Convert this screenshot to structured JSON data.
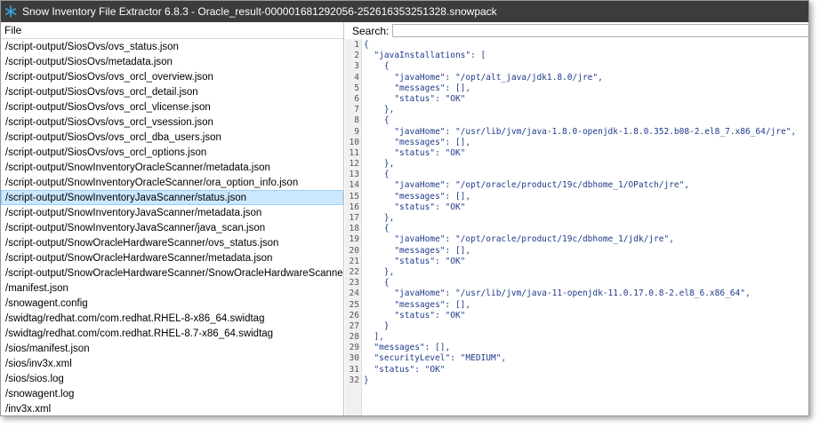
{
  "window": {
    "title": "Snow Inventory File Extractor 6.8.3 - Oracle_result-000001681292056-252616353251328.snowpack",
    "icon": "snowflake-icon",
    "accent_color": "#3aa0d8",
    "titlebar_color": "#3c3c3c"
  },
  "left_pane": {
    "header": "File",
    "selected_index": 10,
    "files": [
      "/script-output/SiosOvs/ovs_status.json",
      "/script-output/SiosOvs/metadata.json",
      "/script-output/SiosOvs/ovs_orcl_overview.json",
      "/script-output/SiosOvs/ovs_orcl_detail.json",
      "/script-output/SiosOvs/ovs_orcl_vlicense.json",
      "/script-output/SiosOvs/ovs_orcl_vsession.json",
      "/script-output/SiosOvs/ovs_orcl_dba_users.json",
      "/script-output/SiosOvs/ovs_orcl_options.json",
      "/script-output/SnowInventoryOracleScanner/metadata.json",
      "/script-output/SnowInventoryOracleScanner/ora_option_info.json",
      "/script-output/SnowInventoryJavaScanner/status.json",
      "/script-output/SnowInventoryJavaScanner/metadata.json",
      "/script-output/SnowInventoryJavaScanner/java_scan.json",
      "/script-output/SnowOracleHardwareScanner/ovs_status.json",
      "/script-output/SnowOracleHardwareScanner/metadata.json",
      "/script-output/SnowOracleHardwareScanner/SnowOracleHardwareScanner.json",
      "/manifest.json",
      "/snowagent.config",
      "/swidtag/redhat.com/com.redhat.RHEL-8-x86_64.swidtag",
      "/swidtag/redhat.com/com.redhat.RHEL-8.7-x86_64.swidtag",
      "/sios/manifest.json",
      "/sios/inv3x.xml",
      "/sios/sios.log",
      "/snowagent.log",
      "/inv3x.xml"
    ]
  },
  "right_pane": {
    "search_label": "Search:",
    "search_value": "",
    "code_lines": [
      "{",
      "  \"javaInstallations\": [",
      "    {",
      "      \"javaHome\": \"/opt/alt_java/jdk1.8.0/jre\",",
      "      \"messages\": [],",
      "      \"status\": \"OK\"",
      "    },",
      "    {",
      "      \"javaHome\": \"/usr/lib/jvm/java-1.8.0-openjdk-1.8.0.352.b08-2.el8_7.x86_64/jre\",",
      "      \"messages\": [],",
      "      \"status\": \"OK\"",
      "    },",
      "    {",
      "      \"javaHome\": \"/opt/oracle/product/19c/dbhome_1/OPatch/jre\",",
      "      \"messages\": [],",
      "      \"status\": \"OK\"",
      "    },",
      "    {",
      "      \"javaHome\": \"/opt/oracle/product/19c/dbhome_1/jdk/jre\",",
      "      \"messages\": [],",
      "      \"status\": \"OK\"",
      "    },",
      "    {",
      "      \"javaHome\": \"/usr/lib/jvm/java-11-openjdk-11.0.17.0.8-2.el8_6.x86_64\",",
      "      \"messages\": [],",
      "      \"status\": \"OK\"",
      "    }",
      "  ],",
      "  \"messages\": [],",
      "  \"securityLevel\": \"MEDIUM\",",
      "  \"status\": \"OK\"",
      "}"
    ]
  }
}
